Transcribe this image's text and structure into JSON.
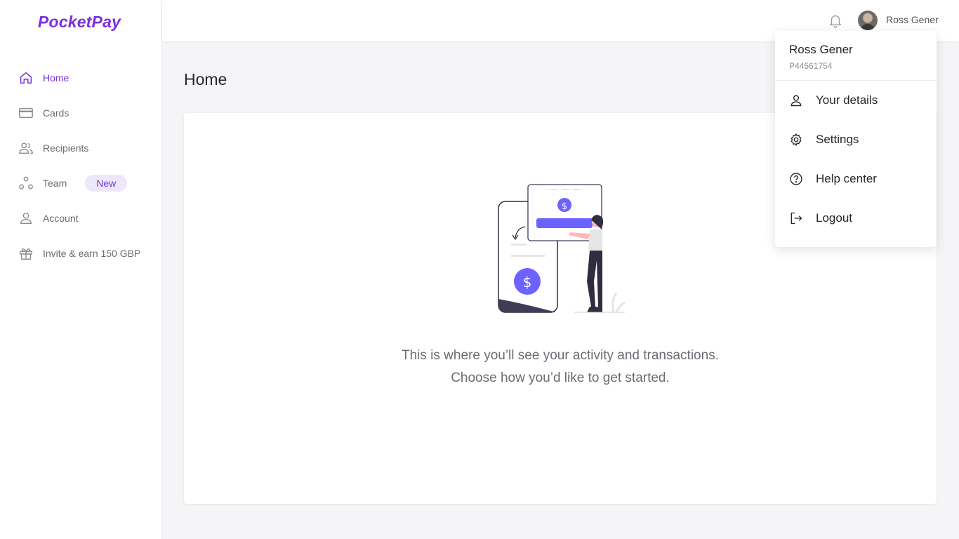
{
  "brand": {
    "name": "PocketPay",
    "accent": "#7b2fe0"
  },
  "sidebar": {
    "items": [
      {
        "label": "Home",
        "icon": "home-icon",
        "active": true
      },
      {
        "label": "Cards",
        "icon": "card-icon"
      },
      {
        "label": "Recipients",
        "icon": "recipients-icon"
      },
      {
        "label": "Team",
        "icon": "team-icon",
        "badge": "New"
      },
      {
        "label": "Account",
        "icon": "account-icon"
      },
      {
        "label": "Invite & earn 150 GBP",
        "icon": "gift-icon"
      }
    ]
  },
  "header": {
    "user_name": "Ross Gener",
    "bell_icon": "bell-icon"
  },
  "main": {
    "title": "Home",
    "empty_line1": "This is where you’ll see your activity and transactions.",
    "empty_line2": "Choose how you’d like to get started."
  },
  "user_menu": {
    "name": "Ross Gener",
    "id": "P44561754",
    "items": [
      {
        "label": "Your details",
        "icon": "user-icon"
      },
      {
        "label": "Settings",
        "icon": "gear-icon"
      },
      {
        "label": "Help center",
        "icon": "help-icon"
      },
      {
        "label": "Logout",
        "icon": "logout-icon"
      }
    ]
  }
}
